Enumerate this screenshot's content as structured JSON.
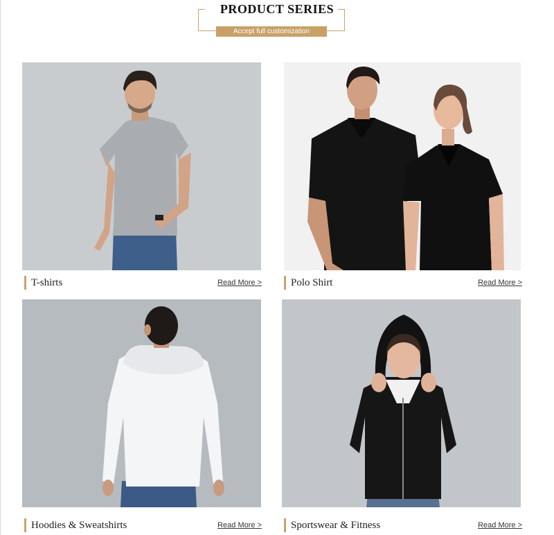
{
  "header": {
    "title": "PRODUCT SERIES",
    "subtitle": "Accept full customization",
    "accent_color": "#c8a068"
  },
  "products": [
    {
      "title": "T-shirts",
      "link": "Read More >",
      "image": "man-grey-tshirt-photo"
    },
    {
      "title": "Polo Shirt",
      "link": "Read More >",
      "image": "couple-black-polo-photo"
    },
    {
      "title": "Hoodies & Sweatshirts",
      "link": "Read More >",
      "image": "man-white-hoodie-back-photo"
    },
    {
      "title": "Sportswear & Fitness",
      "link": "Read More >",
      "image": "woman-black-zip-hoodie-photo"
    }
  ]
}
